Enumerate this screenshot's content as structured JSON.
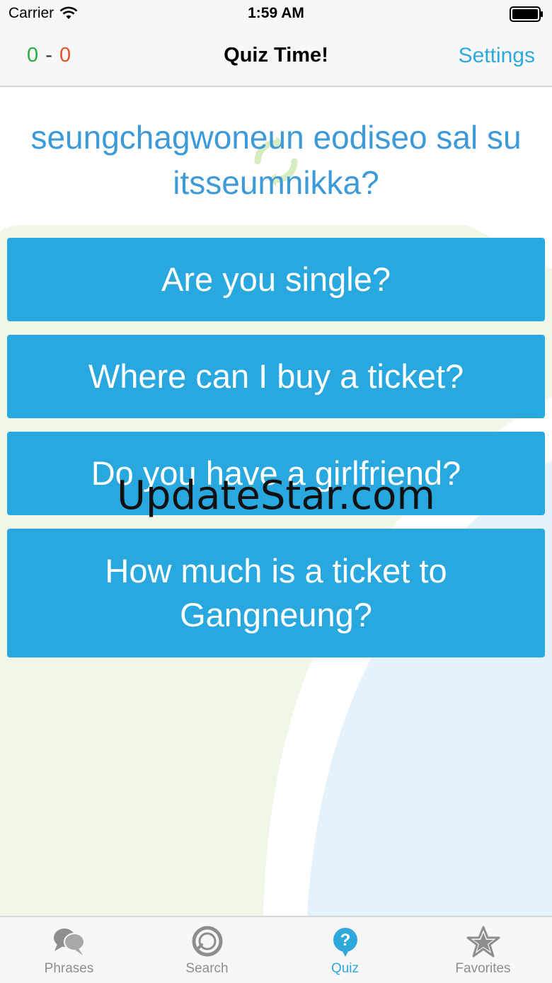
{
  "status_bar": {
    "carrier": "Carrier",
    "time": "1:59 AM"
  },
  "nav": {
    "score_correct": "0",
    "score_separator": "-",
    "score_wrong": "0",
    "title": "Quiz Time!",
    "settings_label": "Settings"
  },
  "quiz": {
    "question": "seungchagwoneun eodiseo sal su itsseumnikka?",
    "answers": [
      {
        "text": "Are you single?"
      },
      {
        "text": "Where can I buy a ticket?"
      },
      {
        "text": "Do you have a girlfriend?"
      },
      {
        "text": "How much is a ticket to Gangneung?"
      }
    ]
  },
  "watermark": "UpdateStar.com",
  "tab_bar": {
    "items": [
      {
        "label": "Phrases",
        "icon": "speech-bubbles-icon",
        "active": false
      },
      {
        "label": "Search",
        "icon": "magnifier-icon",
        "active": false
      },
      {
        "label": "Quiz",
        "icon": "question-bubble-icon",
        "active": true
      },
      {
        "label": "Favorites",
        "icon": "star-icon",
        "active": false
      }
    ]
  },
  "colors": {
    "accent": "#2fa9dc",
    "answer_button": "#29a8e0",
    "question_text": "#3d9ad8",
    "score_correct": "#27ae3f",
    "score_wrong": "#e0522a",
    "tab_inactive": "#8e8e8e"
  }
}
